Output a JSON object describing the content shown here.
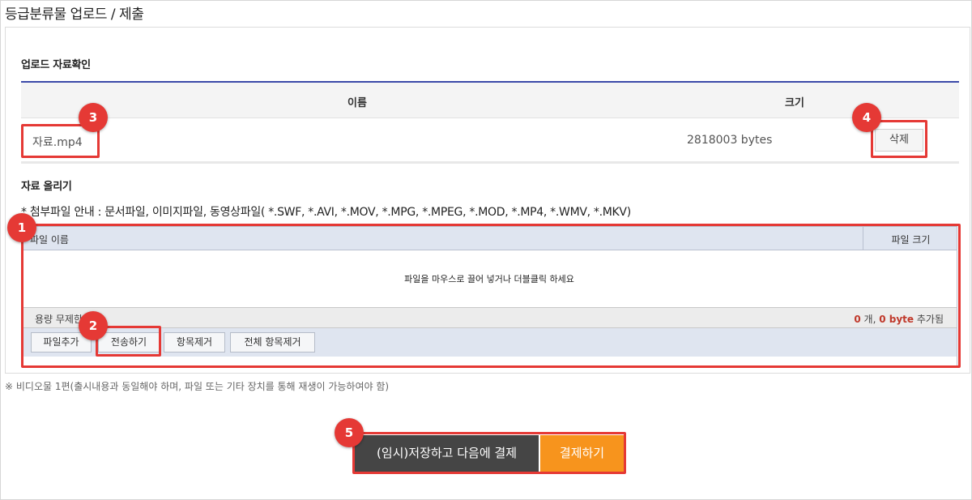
{
  "page_title": "등급분류물 업로드 / 제출",
  "uploaded_section": {
    "title": "업로드 자료확인",
    "columns": {
      "name": "이름",
      "size": "크기"
    },
    "file": {
      "name": "자료.mp4",
      "size": "2818003 bytes"
    },
    "delete_label": "삭제"
  },
  "upload_section": {
    "title": "자료 올리기",
    "guide": "* 첨부파일 안내 : 문서파일, 이미지파일, 동영상파일( *.SWF, *.AVI, *.MOV, *.MPG, *.MPEG, *.MOD, *.MP4, *.WMV, *.MKV)"
  },
  "uploader": {
    "col_name": "파일 이름",
    "col_size": "파일 크기",
    "drop_message": "파일을 마우스로 끌어 넣거나 더블클릭 하세요",
    "capacity": "용량 무제한",
    "count": "0",
    "count_unit": "개,",
    "bytes": "0 byte",
    "added_label": "추가됨",
    "buttons": {
      "add": "파일추가",
      "send": "전송하기",
      "remove": "항목제거",
      "remove_all": "전체 항목제거"
    }
  },
  "note": "※ 비디오물 1편(출시내용과 동일해야 하며, 파일 또는 기타 장치를 통해 재생이 가능하여야 함)",
  "actions": {
    "save": "(임시)저장하고 다음에 결제",
    "pay": "결제하기"
  },
  "badges": [
    "1",
    "2",
    "3",
    "4",
    "5"
  ],
  "colors": {
    "annotation": "#e53935",
    "pay": "#f7941d",
    "save": "#454545",
    "table_topline": "#3b4aa8"
  }
}
